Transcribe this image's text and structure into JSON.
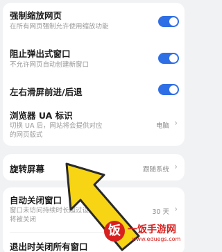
{
  "settings": {
    "zoom": {
      "title": "强制缩放网页",
      "desc": "在所有网页强制允许使用缩放功能",
      "enabled": true
    },
    "popup": {
      "title": "阻止弹出式窗口",
      "desc": "不允许网页自动创建新窗口",
      "enabled": true
    },
    "swipe": {
      "title": "左右滑屏前进/后退",
      "enabled": true
    },
    "ua": {
      "title": "浏览器 UA 标识",
      "desc_line1": "切换 UA 后，网站将会提供对应",
      "desc_line2": "的网页版式",
      "value": "电脑"
    },
    "rotate": {
      "title": "旋转屏幕",
      "value": "跟随系统"
    },
    "autoclose": {
      "title": "自动关闭窗口",
      "desc_line1": "窗口未访问持续时长超过设定",
      "desc_line2": "将被关闭",
      "value": "30 天"
    },
    "exitclose": {
      "title": "退出时关闭所有窗口"
    }
  },
  "watermark": {
    "logo_char": "饭",
    "name": "一饭手游网",
    "url": "www.eduegs.com"
  },
  "colors": {
    "accent": "#2f6fe6",
    "arrow_fill": "#f7d414",
    "arrow_stroke": "#2a2a2a",
    "watermark_red": "#d8211f"
  }
}
